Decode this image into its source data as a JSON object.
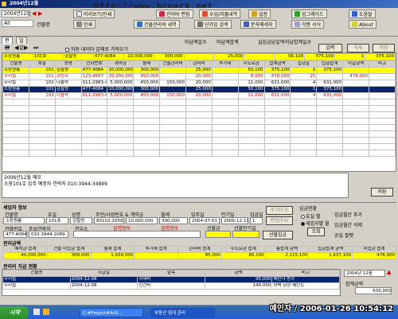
{
  "window": {
    "title": "2004년12월"
  },
  "watermark": "http://www.bcpark.net",
  "toolbar": {
    "date": "2004년12월",
    "view_button": "미리보기/인쇄",
    "row1": [
      "관리비 편집",
      "수입/지출내역",
      "설정",
      "업그레이드",
      "도움말"
    ],
    "row2": [
      "인쇄",
      "건물관리비 내역",
      "단가입 검색",
      "문자메세지",
      "각종 서식",
      "About"
    ],
    "filter_value": "All",
    "filter_label": "건물명"
  },
  "tabs": [
    "편집",
    "일괄편집"
  ],
  "options": {
    "auto_copy_label": "자동 데이타 갑체로 가져오기"
  },
  "summary": {
    "totals": [
      "소장원룸",
      "101호",
      "김철영",
      "477-4084",
      "10,000,000",
      "300,000",
      "",
      "25,000",
      "",
      "56,100",
      "375,100",
      "1",
      "375,100"
    ],
    "head_labels": [
      "미납액일수",
      "미납액합계",
      "실입금납일액",
      "미납합계일수"
    ],
    "insert_btn": "입력",
    "delete_btn": "삭제",
    "save_btn": "저장"
  },
  "grid": {
    "headers": [
      "건물명",
      "호실",
      "성명",
      "전화번호",
      "계약금",
      "월세",
      "건물관리비",
      "관리비",
      "부가세",
      "수도요금",
      "합계금액",
      "입금일",
      "입금합계",
      "미납금액",
      "비고"
    ],
    "rows": [
      {
        "cells": [
          "소장원룸",
          "101",
          "김철영",
          "477-4084",
          "10,000,000",
          "300,000",
          "",
          "25,000",
          "",
          "50,100",
          "375,100",
          "1",
          "375,100",
          "",
          ""
        ],
        "style": "yellow"
      },
      {
        "cells": [
          "우리빌",
          "101",
          "강민자",
          "123-4567",
          "20,000,000",
          "450,000",
          "",
          "20,000",
          "",
          "8,000",
          "478,000",
          "25",
          "",
          "478,000",
          ""
        ],
        "style": "red"
      },
      {
        "cells": [
          "우리빌",
          "102",
          "나몰락",
          "011-2983-4939",
          "5,000,000",
          "450,000",
          "150,000",
          "20,000",
          "",
          "11,000",
          "631,000",
          "4",
          "631,000",
          "",
          ""
        ],
        "style": "normal"
      },
      {
        "cells": [
          "소장원룸",
          "101",
          "김철영",
          "477-4084",
          "10,000,000",
          "300,000",
          "",
          "25,000",
          "",
          "50,100",
          "375,100",
          "1",
          "375,100",
          "",
          ""
        ],
        "style": "selected"
      },
      {
        "cells": [
          "우리빌",
          "102",
          "나몰락",
          "011-2983-4939",
          "5,000,000",
          "450,000",
          "150,000",
          "20,000",
          "",
          "11,000",
          "631,000",
          "4",
          "631,000",
          "",
          ""
        ],
        "style": "red"
      }
    ]
  },
  "memo": {
    "title": "2006년12월 메모",
    "text": "소장101호 입주 예정자 연락처 010-3944-34899",
    "button": "저장"
  },
  "detail": {
    "section": "세입자 정보",
    "headers": [
      "건물명",
      "호실",
      "성명",
      "주민/사업번호 & 계약금",
      "월세",
      "입주일",
      "만기일",
      "입금일"
    ],
    "values": [
      "소장원룸",
      "101호",
      "김철영",
      "80102-2059858",
      "10,000,000",
      "300,000",
      "2004-07-01",
      "2006-12-19",
      "1"
    ],
    "phone_label": "전화번호",
    "phone": "477-4084",
    "owner_label": "주요연락처",
    "owner": "010-3944-2089",
    "mgmt_label": "전우소",
    "red1": "설명정보",
    "red2": "설명정보",
    "prepay_label": "선불금",
    "prepay_month_label": "선불만기일",
    "prepay_btn": "선불입금",
    "add_btn": "추가(F3)",
    "edit_btn": "편집(F4)",
    "del_btn": "삭제(F5)",
    "sum_label": "관리금액",
    "sum_headers": [
      "예치금 합계",
      "건물 미입금 합계",
      "월세 합계",
      "부가세 합계",
      "관리비 합계",
      "수도요금 합계",
      "총합계 금액",
      "입금합계 금액",
      "미입금 합계"
    ],
    "sum_values": [
      "40,000,000",
      "308,000",
      "1,650,000",
      "",
      "85,000",
      "80,100",
      "2,115,100",
      "1,637,100",
      "478,000"
    ],
    "status_group": "입금현황",
    "opt1": "호실 별",
    "opt2": "세입자별 월",
    "search_btn": "조회",
    "side_labels": [
      "입금월간 추가",
      "입금월간 삭제",
      "공실 팔렛"
    ]
  },
  "payments": {
    "section": "관리비 지급 현황",
    "headers": [
      "건물명",
      "지급일",
      "항목",
      "금액",
      "비고"
    ],
    "rows": [
      {
        "cells": [
          "우리빌",
          "2004-12-08",
          "자재비",
          "95,000",
          "베란다 방수"
        ],
        "selected": true
      },
      {
        "cells": [
          "우리빌",
          "2004-12-08",
          "인건비",
          "140,000",
          "외벽 담장 페인트"
        ],
        "selected": false
      }
    ],
    "month": "2004년 12월",
    "total_label": "합계금액",
    "total": "635,000"
  },
  "taskbar": {
    "start": "시작",
    "tasks": [
      "C:#Project#AcR...",
      "부동산 임대 관리"
    ]
  },
  "stamp": "예인자 / 2006-01-26 10:54:12"
}
